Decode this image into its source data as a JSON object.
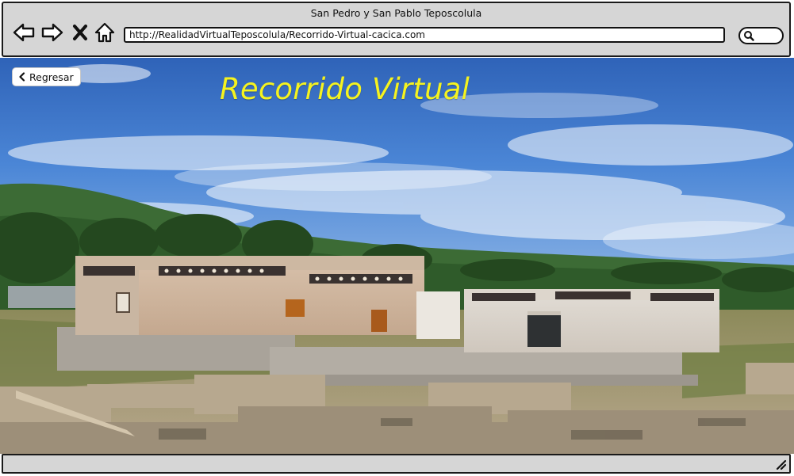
{
  "browser": {
    "title": "San Pedro y San Pablo Teposcolula",
    "url": "http://RealidadVirtualTeposcolula/Recorrido-Virtual-cacica.com",
    "buttons": {
      "back": "arrow-left-icon",
      "forward": "arrow-right-icon",
      "stop": "close-icon",
      "home": "home-icon"
    },
    "search_icon": "search-icon"
  },
  "page": {
    "back_button_label": "Regresar",
    "back_button_icon": "chevron-left-icon",
    "heading": "Recorrido Virtual",
    "heading_color": "#f5f31f"
  },
  "colors": {
    "chrome": "#d6d6d6",
    "sky": "#3f76c9",
    "stone": "#c9b8a2"
  }
}
